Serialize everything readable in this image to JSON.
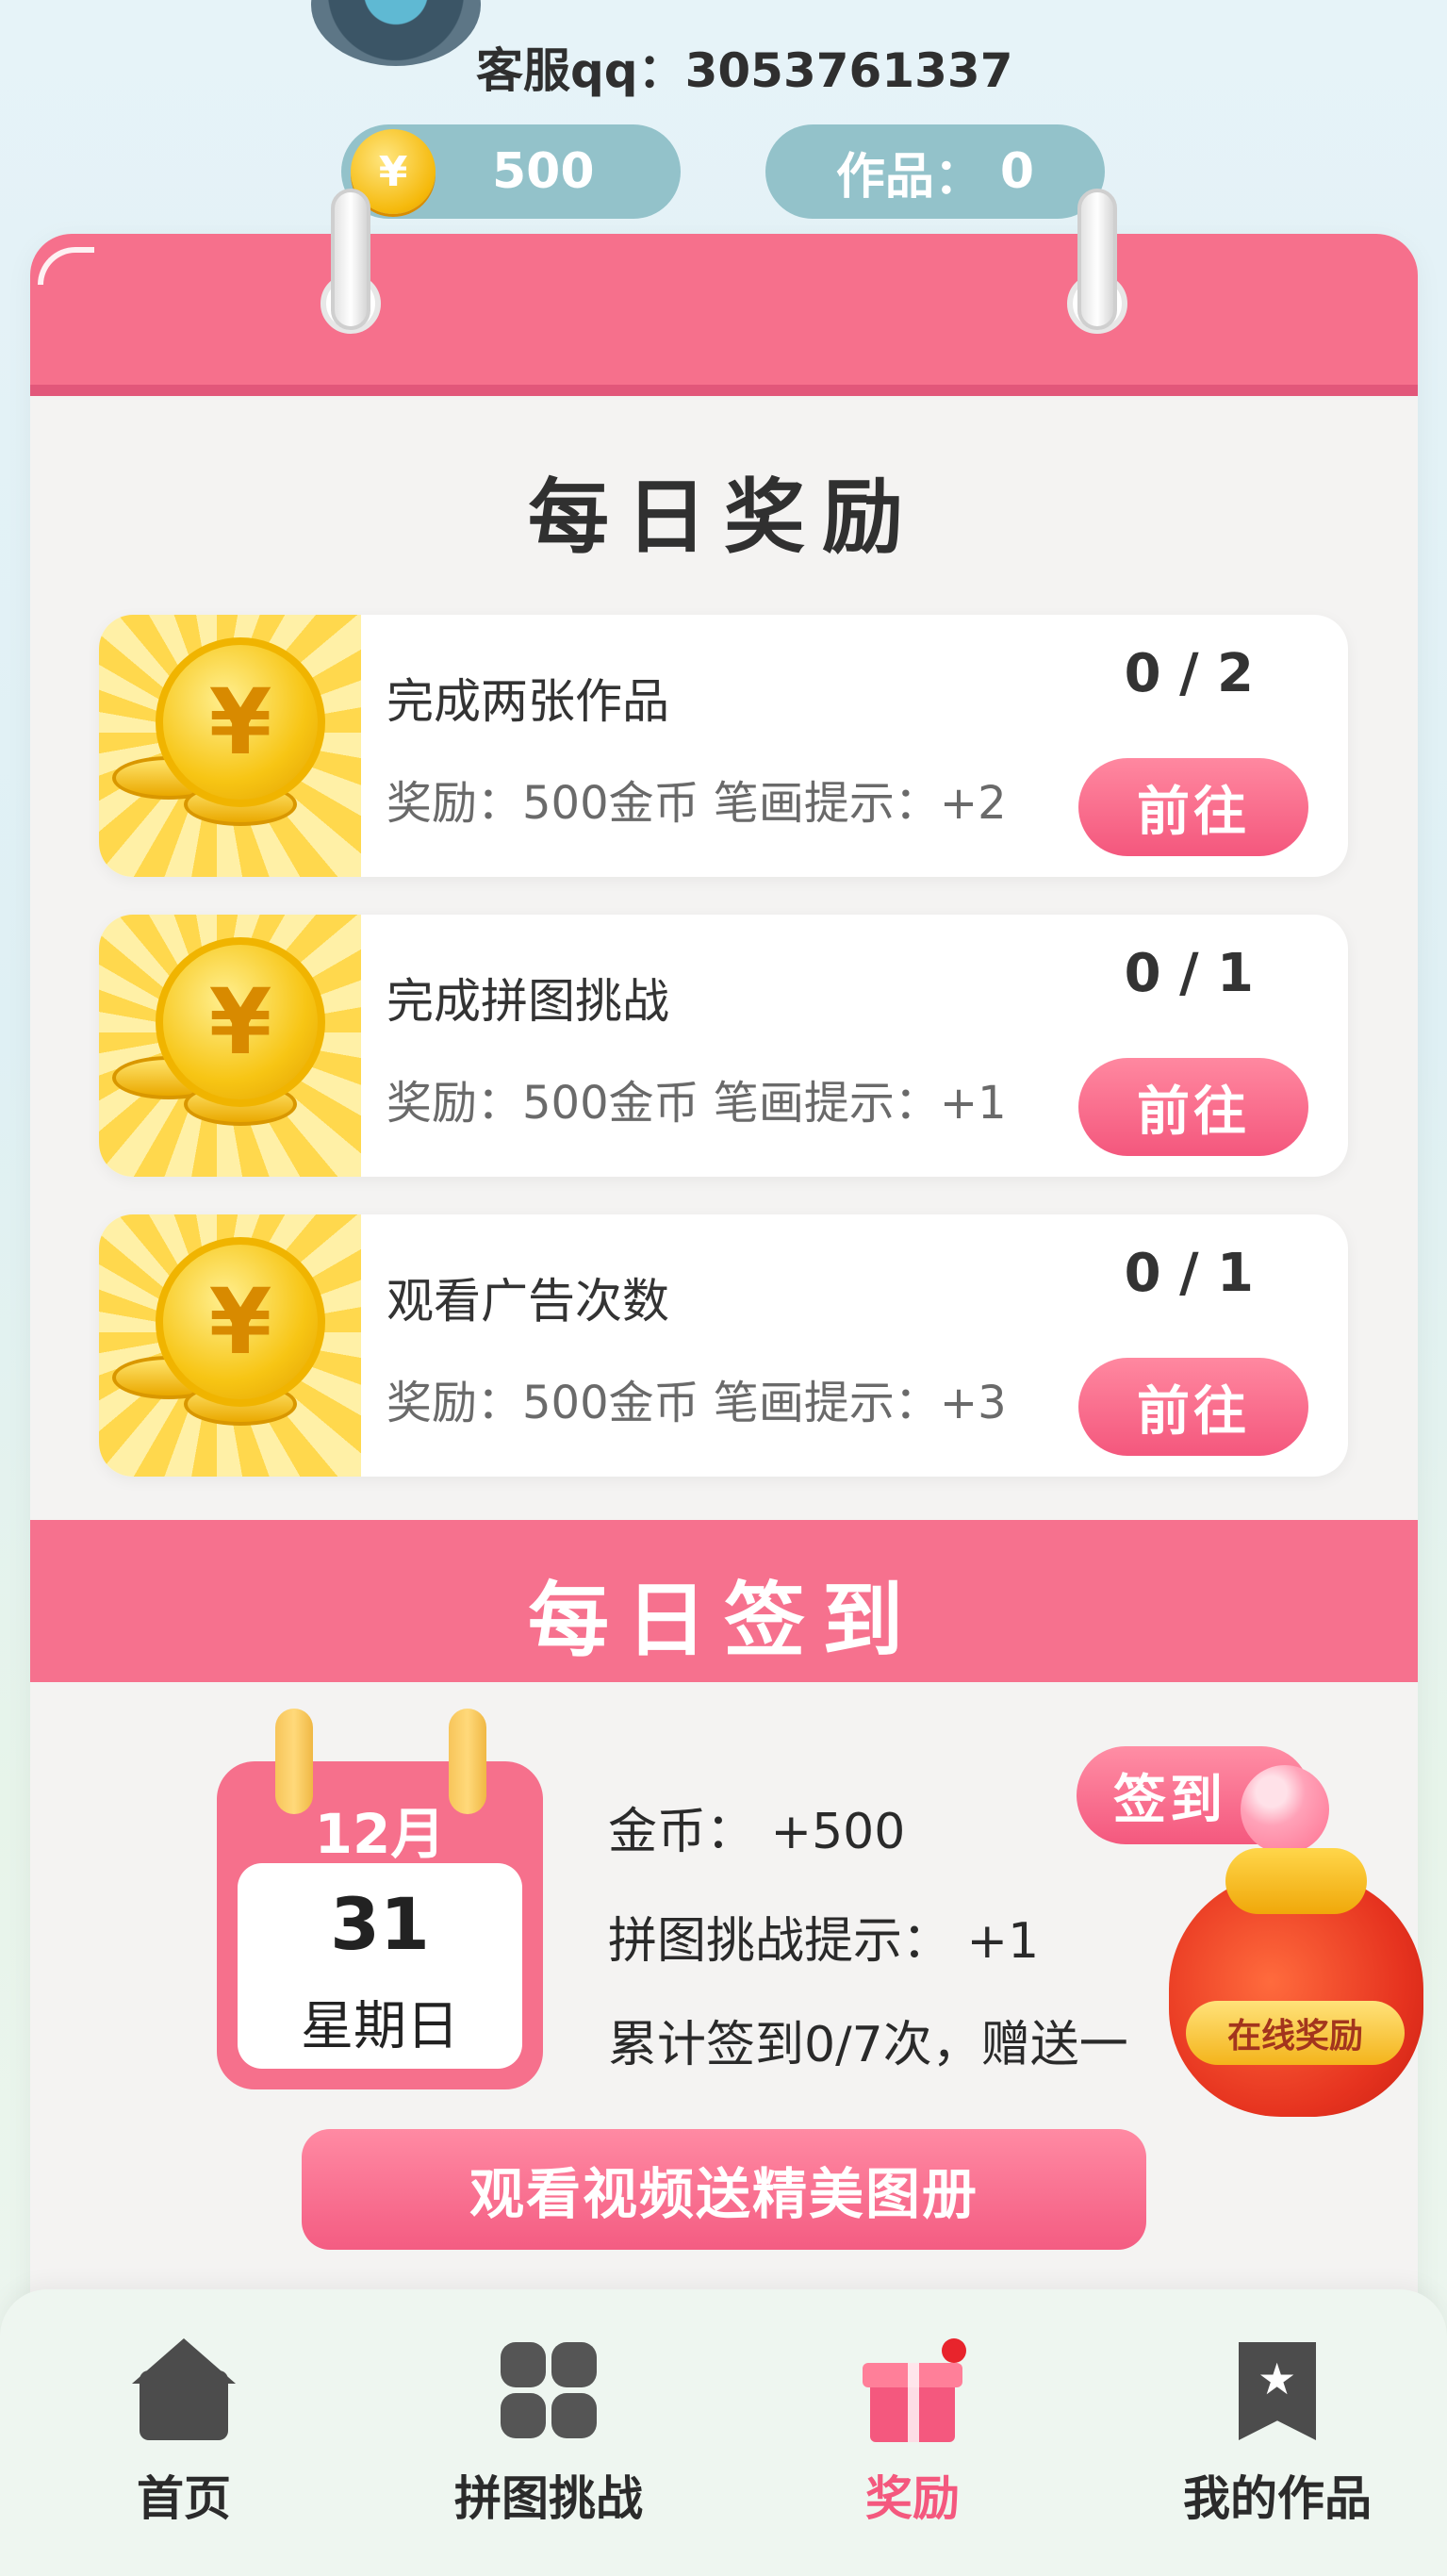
{
  "header": {
    "service_qq": "客服qq：3053761337",
    "coin_symbol": "¥",
    "coins": "500",
    "works_label": "作品：",
    "works_count": "0"
  },
  "daily_reward": {
    "title": "每日奖励",
    "tasks": [
      {
        "name": "完成两张作品",
        "reward": "奖励：500金币  笔画提示：+2",
        "progress": "0 / 2",
        "button": "前往"
      },
      {
        "name": "完成拼图挑战",
        "reward": "奖励：500金币  笔画提示：+1",
        "progress": "0 / 1",
        "button": "前往"
      },
      {
        "name": "观看广告次数",
        "reward": "奖励：500金币  笔画提示：+3",
        "progress": "0 / 1",
        "button": "前往"
      }
    ]
  },
  "daily_signin": {
    "title": "每日签到",
    "calendar": {
      "month": "12月",
      "day": "31",
      "weekday": "星期日"
    },
    "coins_line": "金币：  +500",
    "puzzle_hint_line": "拼图挑战提示：  +1",
    "cumulative_line": "累计签到0/7次，赠送一",
    "sign_button": "签到",
    "bag_label": "在线奖励",
    "video_button": "观看视频送精美图册"
  },
  "bottom_nav": [
    {
      "label": "首页",
      "icon": "home-icon",
      "active": false
    },
    {
      "label": "拼图挑战",
      "icon": "grid-icon",
      "active": false
    },
    {
      "label": "奖励",
      "icon": "gift-icon",
      "active": true
    },
    {
      "label": "我的作品",
      "icon": "bookmark-star-icon",
      "active": false
    }
  ],
  "colors": {
    "accent": "#f6708c",
    "pill": "#93c2ca",
    "active_tab": "#f4587e"
  }
}
